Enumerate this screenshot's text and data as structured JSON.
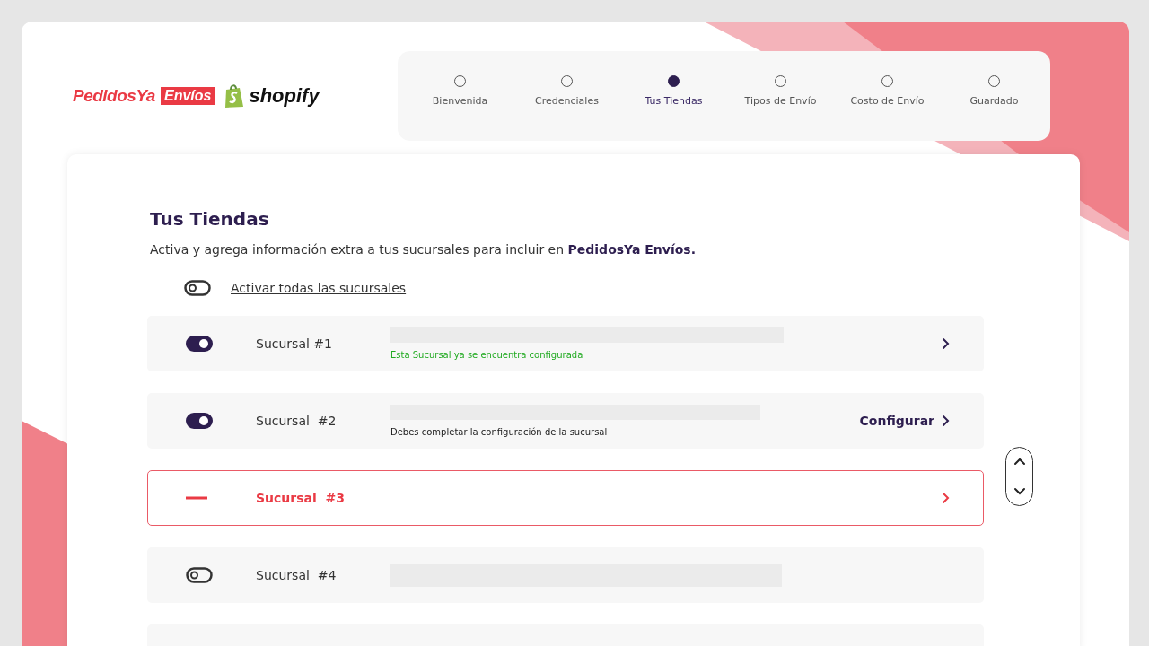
{
  "logo": {
    "brand": "PedidosYa",
    "badge": "Envíos",
    "partner": "shopify"
  },
  "steps": [
    {
      "label": "Bienvenida",
      "selected": false
    },
    {
      "label": "Credenciales",
      "selected": false
    },
    {
      "label": "Tus Tiendas",
      "selected": true
    },
    {
      "label": "Tipos de Envío",
      "selected": false
    },
    {
      "label": "Costo de Envío",
      "selected": false
    },
    {
      "label": "Guardado",
      "selected": false
    }
  ],
  "title": "Tus Tiendas",
  "description": "Activa y agrega información extra a tus sucursales para incluir en **PedidosYa Envíos.**",
  "activate_all": {
    "label": "Activar todas las sucursales",
    "on": false
  },
  "branches": [
    {
      "kind": "toggle",
      "name": "Sucursal #1",
      "on": true,
      "message": {
        "text": "Esta Sucursal ya se encuentra configurada",
        "color": "#22aa22"
      },
      "arrow": true
    },
    {
      "kind": "toggle",
      "name": "Sucursal  #2",
      "on": true,
      "message": {
        "text": "Debes completar la configuración de la sucursal",
        "color": "#222222"
      },
      "action": "Configurar"
    },
    {
      "kind": "error",
      "name": "Sucursal  #3",
      "arrow": true
    },
    {
      "kind": "toggle",
      "name": "Sucursal  #4",
      "on": false,
      "arrow": false
    }
  ]
}
